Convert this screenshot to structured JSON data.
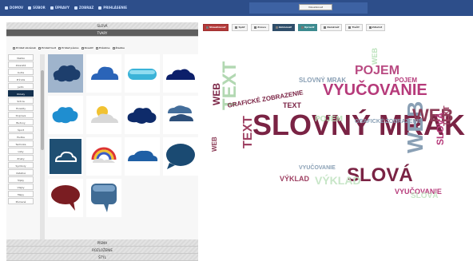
{
  "topbar": {
    "nav": [
      {
        "icon": "home-icon",
        "label": "DOMOV"
      },
      {
        "icon": "file-icon",
        "label": "SÚBOR"
      },
      {
        "icon": "edit-icon",
        "label": "ÚPRAVY"
      },
      {
        "icon": "view-icon",
        "label": "ZOBRAZ"
      },
      {
        "icon": "user-icon",
        "label": "PRIHLÁSENIE"
      }
    ],
    "tooltip": "Vizualizovať"
  },
  "accordion": {
    "words_label": "SLOVÁ",
    "shapes_label": "TVARY",
    "fonts_label": "PÍSMA",
    "layout_label": "ROZLOŽENIE",
    "style_label": "ŠTÝL"
  },
  "shape_tools": [
    {
      "icon": "image-icon",
      "label": "Pridať obrázok"
    },
    {
      "icon": "text-icon",
      "label": "Pridať text"
    },
    {
      "icon": "font-icon",
      "label": "Pridať písmo"
    },
    {
      "icon": "draw-icon",
      "label": "Kresliť"
    },
    {
      "icon": "blank-icon",
      "label": "Prázdne"
    },
    {
      "icon": "none-icon",
      "label": "Žiadne"
    }
  ],
  "categories": [
    "Všetko",
    "Zvieratá",
    "Ľudia",
    "Príroda",
    "Jedlo",
    "Oblaky",
    "Srdcia",
    "Hviezdy",
    "Doprava",
    "Budovy",
    "Šport",
    "Hudba",
    "Technika",
    "Listy",
    "Znaky",
    "Symboly",
    "Ostatné",
    "Šípky",
    "Vlajky",
    "Mapy",
    "Písmená"
  ],
  "active_category": "Oblaky",
  "action_toolbar": [
    {
      "icon": "play-icon",
      "label": "Vizualizovať",
      "style": "red"
    },
    {
      "icon": "undo-icon",
      "label": "Späť",
      "style": "plain"
    },
    {
      "icon": "redo-icon",
      "label": "Znovu",
      "style": "plain"
    },
    {
      "icon": "animate-icon",
      "label": "Animovať",
      "style": "dark"
    },
    {
      "icon": "edit-icon",
      "label": "Upraviť",
      "style": "teal"
    },
    {
      "icon": "lock-icon",
      "label": "Zamknúť",
      "style": "plain"
    },
    {
      "icon": "print-icon",
      "label": "Tlačiť",
      "style": "plain"
    },
    {
      "icon": "share-icon",
      "label": "Zdieľať",
      "style": "plain"
    }
  ],
  "word_cloud": {
    "words": [
      {
        "text": "SLOVNÝ MRAK",
        "color": "#7a2344"
      },
      {
        "text": "VYUČOVANIE",
        "color": "#b63a7a"
      },
      {
        "text": "WEB",
        "color": "#8aa0b5"
      },
      {
        "text": "WEB",
        "color": "#8a3a55"
      },
      {
        "text": "TEXT",
        "color": "#b2d8b2"
      },
      {
        "text": "TEXT",
        "color": "#9e4062"
      },
      {
        "text": "POJEM",
        "color": "#b94a82"
      },
      {
        "text": "SLOVÁ",
        "color": "#7a2344"
      },
      {
        "text": "SLOVÁ",
        "color": "#b63a7a"
      },
      {
        "text": "WEB",
        "color": "#bde3bd"
      },
      {
        "text": "VÝKLAD",
        "color": "#c8e6c8"
      },
      {
        "text": "GRAFICKÉ ZOBRAZENIE",
        "color": "#7a2344"
      },
      {
        "text": "SLOVNÝ MRAK",
        "color": "#8aa0b5"
      },
      {
        "text": "VYUČOVANIE",
        "color": "#b63a7a"
      },
      {
        "text": "POJEM",
        "color": "#bde3bd"
      },
      {
        "text": "WEB",
        "color": "#8a3a55"
      },
      {
        "text": "TEXT",
        "color": "#7a2344"
      },
      {
        "text": "GRAFICKÉ ZOBRAZENIE",
        "color": "#8aa0b5"
      },
      {
        "text": "VÝKLAD",
        "color": "#9e4062"
      },
      {
        "text": "SLOVÁ",
        "color": "#c8e6c8"
      },
      {
        "text": "WEB",
        "color": "#7a2344"
      },
      {
        "text": "VYUČOVANIE",
        "color": "#8aa0b5"
      },
      {
        "text": "POJEM",
        "color": "#b63a7a"
      },
      {
        "text": "TEXT",
        "color": "#9e4062"
      }
    ]
  }
}
